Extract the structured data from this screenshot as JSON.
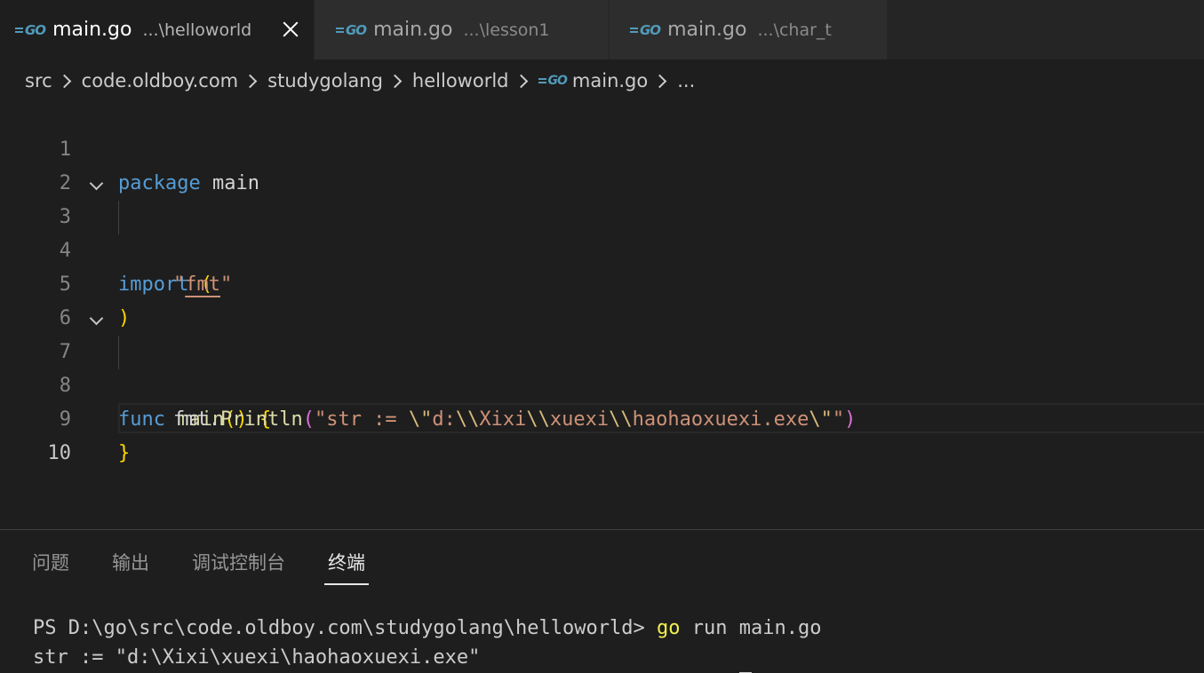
{
  "tabs": [
    {
      "title": "main.go",
      "description": "...\\helloworld",
      "active": true
    },
    {
      "title": "main.go",
      "description": "...\\lesson1",
      "active": false
    },
    {
      "title": "main.go",
      "description": "...\\char_t",
      "active": false
    }
  ],
  "icons": {
    "go_file": "go-icon",
    "close": "close-icon",
    "fold": "chevron-down-icon",
    "separator": "chevron-right-icon"
  },
  "go_icon_text": "GO",
  "breadcrumb": [
    "src",
    "code.oldboy.com",
    "studygolang",
    "helloworld",
    "main.go",
    "..."
  ],
  "editor": {
    "line_numbers": [
      "1",
      "2",
      "3",
      "4",
      "5",
      "6",
      "7",
      "8",
      "9",
      "10"
    ],
    "current_line": 10,
    "lines": {
      "l1": {
        "kw": "package",
        "rest": " main"
      },
      "l3": {
        "kw": "import",
        "paren": "("
      },
      "l4": {
        "q1": "\"",
        "pkg": "fmt",
        "q2": "\""
      },
      "l5": {
        "paren": ")"
      },
      "l7": {
        "kw": "func",
        "name": "main",
        "parens": "()",
        "brace": "{"
      },
      "l8": {
        "obj": "fmt.",
        "fn": "Println",
        "open": "(",
        "s1": "\"str := ",
        "e1": "\\\"",
        "s2": "d:",
        "e2": "\\\\",
        "s3": "Xixi",
        "e3": "\\\\",
        "s4": "xuexi",
        "e4": "\\\\",
        "s5": "haohaoxuexi.exe",
        "e5": "\\\"",
        "s6": "\"",
        "close": ")"
      },
      "l9": {
        "brace": "}"
      }
    }
  },
  "panel": {
    "tabs": [
      "问题",
      "输出",
      "调试控制台",
      "终端"
    ],
    "active_tab": "终端",
    "terminal": {
      "prompt": "PS D:\\go\\src\\code.oldboy.com\\studygolang\\helloworld> ",
      "command": "go",
      "args": " run main.go",
      "output": "str := \"d:\\Xixi\\xuexi\\haohaoxuexi.exe\""
    }
  },
  "colors": {
    "keyword": "#569cd6",
    "function": "#dcdcaa",
    "string": "#ce9178",
    "escape": "#d7ba7d",
    "bracket_gold": "#ffd700",
    "bracket_purple": "#da70d6",
    "go_icon": "#519aba",
    "terminal_command": "#f0f04c"
  }
}
